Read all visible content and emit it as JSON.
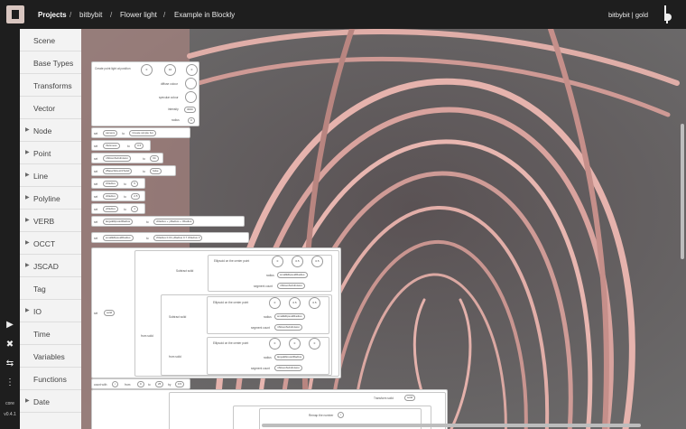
{
  "header": {
    "breadcrumbs": [
      "Projects",
      "bitbybit",
      "Flower light",
      "Example in Blockly"
    ],
    "user": "bitbybit | gold"
  },
  "rail": {
    "icons": [
      "play-icon",
      "tools-icon",
      "swap-icon",
      "more-icon"
    ],
    "core_label": "core",
    "version": "v0.4.1"
  },
  "toolbox": {
    "categories": [
      {
        "label": "Scene",
        "arrow": false
      },
      {
        "label": "Base Types",
        "arrow": false
      },
      {
        "label": "Transforms",
        "arrow": false
      },
      {
        "label": "Vector",
        "arrow": false
      },
      {
        "label": "Node",
        "arrow": true
      },
      {
        "label": "Point",
        "arrow": true
      },
      {
        "label": "Line",
        "arrow": true
      },
      {
        "label": "Polyline",
        "arrow": true
      },
      {
        "label": "VERB",
        "arrow": true
      },
      {
        "label": "OCCT",
        "arrow": true
      },
      {
        "label": "JSCAD",
        "arrow": true
      },
      {
        "label": "Tag",
        "arrow": false
      },
      {
        "label": "IO",
        "arrow": true
      },
      {
        "label": "Time",
        "arrow": false
      },
      {
        "label": "Variables",
        "arrow": false
      },
      {
        "label": "Functions",
        "arrow": false
      },
      {
        "label": "Date",
        "arrow": true
      }
    ]
  },
  "blocks": {
    "light": {
      "title": "Create point light at position",
      "coords": [
        "x",
        "0",
        "y",
        "10",
        "z",
        "0"
      ],
      "labels": [
        "diffuse colour",
        "specular colour",
        "intensity",
        "radius"
      ],
      "intensity": "3000",
      "radius": "0"
    },
    "sets": [
      {
        "var": "camera",
        "value": "Create simple fun"
      },
      {
        "var": "thickness",
        "value": "0.5"
      },
      {
        "var": "nSlicesSubdivision",
        "value": "64"
      },
      {
        "var": "zBaseSlicesOrSolid",
        "value": "false"
      },
      {
        "var": "zRadius",
        "value": "5"
      },
      {
        "var": "xRadius",
        "value": "2.5"
      },
      {
        "var": "yRadius",
        "value": "1"
      },
      {
        "var": "largeEllipsoidRadius",
        "value": "xRadius + yRadius + zRadius"
      },
      {
        "var": "smallEllipsoidRadius",
        "value": "zRadius 0.04 yRadius 0.7 zRadius 3"
      }
    ],
    "solid": {
      "var": "solid",
      "subtract": "Subtract solid",
      "from_solid": "from solid",
      "ellipsoid1": "Ellipsoid on the center point",
      "ellipsoid2": "Ellipsoid on the center point",
      "ellipsoid3": "Ellipsoid on the center point",
      "coords1": [
        "0",
        "0.5",
        "0.5"
      ],
      "coords2": [
        "0",
        "0.5",
        "0.5"
      ],
      "coords3": [
        "0",
        "0",
        "0"
      ],
      "radius_var1": "smallEllipsoidRadius",
      "radius_var2": "smallEllipsoidRadius",
      "radius_var3": "largeEllipsoidRadius",
      "segment_var1": "nSlicesSubdivision",
      "segment_var2": "nSlicesSubdivision",
      "segment_var3": "nSlicesSubdivision",
      "radius_label": "radius",
      "segment_label": "segment count"
    },
    "count": {
      "label": "count with",
      "var": "i",
      "from": "0",
      "to": "25",
      "by": "0.5",
      "transform": "Transform solid",
      "transform_var": "solid",
      "remap": "Remap the number",
      "remap_value": "i"
    }
  }
}
